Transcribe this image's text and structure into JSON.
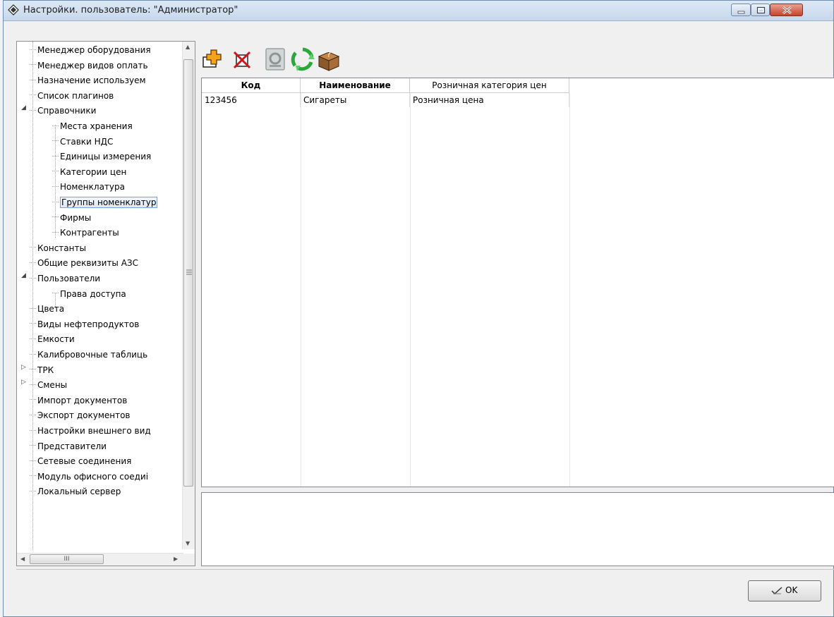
{
  "window": {
    "title": "Настройки. пользователь: \"Администратор\"",
    "controls": [
      "minimize",
      "maximize",
      "close"
    ]
  },
  "tree": {
    "items": [
      {
        "label": "Менеджер оборудования"
      },
      {
        "label": "Менеджер видов оплать"
      },
      {
        "label": "Назначение используем"
      },
      {
        "label": "Список плагинов"
      },
      {
        "label": "Справочники",
        "expanded": true
      },
      {
        "label": "Места хранения"
      },
      {
        "label": "Ставки НДС"
      },
      {
        "label": "Единицы измерения"
      },
      {
        "label": "Категории цен"
      },
      {
        "label": "Номенклатура"
      },
      {
        "label": "Группы номенклатур",
        "selected": true
      },
      {
        "label": "Фирмы"
      },
      {
        "label": "Контрагенты"
      },
      {
        "label": "Константы"
      },
      {
        "label": "Общие реквизиты АЗС"
      },
      {
        "label": "Пользователи",
        "expanded": true
      },
      {
        "label": "Права доступа"
      },
      {
        "label": "Цвета"
      },
      {
        "label": "Виды нефтепродуктов"
      },
      {
        "label": "Емкости"
      },
      {
        "label": "Калибровочные таблиць"
      },
      {
        "label": "ТРК",
        "expanded": false
      },
      {
        "label": "Смены",
        "expanded": false
      },
      {
        "label": "Импорт документов"
      },
      {
        "label": "Экспорт документов"
      },
      {
        "label": "Настройки внешнего вид"
      },
      {
        "label": "Представители"
      },
      {
        "label": "Сетевые соединения"
      },
      {
        "label": "Модуль офисного соедиі"
      },
      {
        "label": "Локальный сервер"
      }
    ],
    "hscroll_thumb": "III"
  },
  "toolbar": {
    "buttons": [
      {
        "name": "add-icon",
        "enabled": true
      },
      {
        "name": "delete-icon",
        "enabled": true
      },
      {
        "name": "edit-icon",
        "enabled": false
      },
      {
        "name": "refresh-icon",
        "enabled": true
      },
      {
        "name": "help-box-icon",
        "enabled": true
      }
    ]
  },
  "grid": {
    "columns": [
      "Код",
      "Наименование",
      "Розничная категория цен"
    ],
    "rows": [
      [
        "123456",
        "Сигареты",
        "Розничная цена"
      ]
    ]
  },
  "footer": {
    "ok_label": "OK"
  },
  "colors": {
    "title_bar": "#c7d8ec",
    "selection": "#dce9f8",
    "close_button": "#c7432c"
  }
}
